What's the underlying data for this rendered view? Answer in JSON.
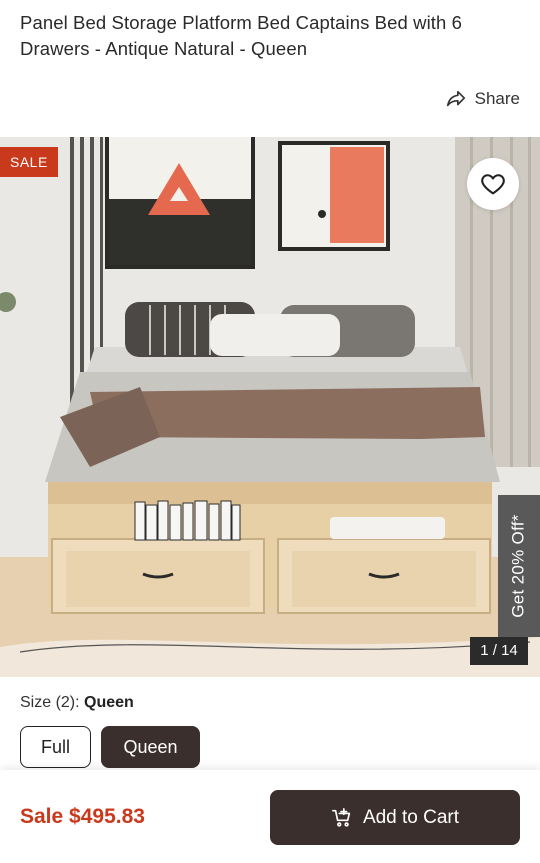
{
  "product": {
    "title": "Panel Bed Storage Platform Bed Captains Bed with 6 Drawers - Antique Natural - Queen"
  },
  "share": {
    "label": "Share",
    "icon": "share-arrow-icon"
  },
  "gallery": {
    "sale_badge": "SALE",
    "promo_tab": "Get 20% Off*",
    "counter": "1 / 14",
    "wishlist_icon": "heart-outline-icon"
  },
  "size": {
    "label": "Size (2):",
    "selected_value": "Queen",
    "options": [
      {
        "label": "Full",
        "selected": false
      },
      {
        "label": "Queen",
        "selected": true
      }
    ]
  },
  "purchase": {
    "price": "Sale $495.83",
    "add_to_cart": "Add to Cart",
    "cart_icon": "cart-plus-icon"
  },
  "colors": {
    "sale_red": "#c9391c",
    "primary_dark": "#3a2f2c",
    "promo_gray": "#595959"
  }
}
